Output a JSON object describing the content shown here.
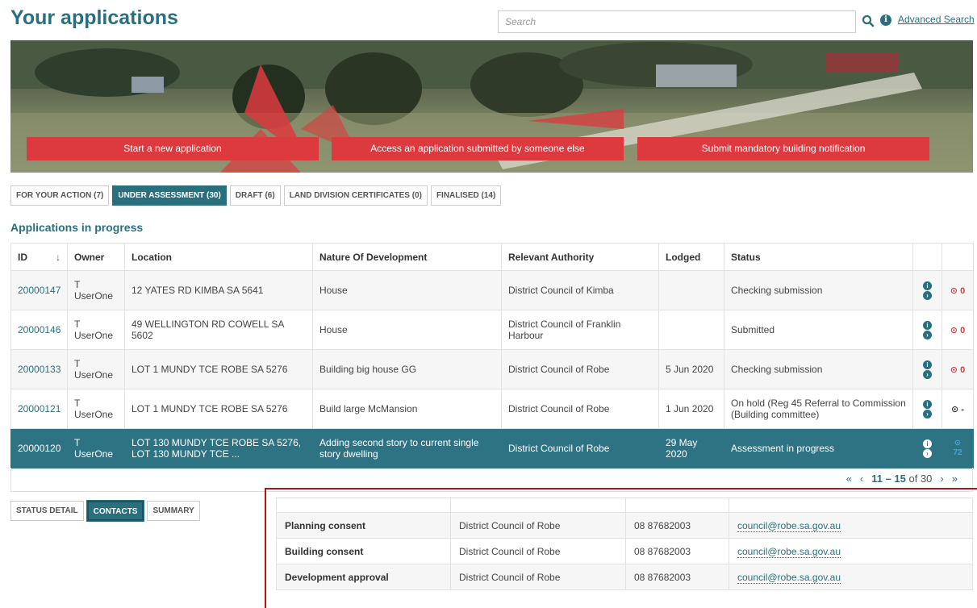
{
  "page_title": "Your applications",
  "search": {
    "placeholder": "Search",
    "advanced_label": "Advanced Search"
  },
  "banner_buttons": [
    "Start a new application",
    "Access an application submitted by someone else",
    "Submit mandatory building notification"
  ],
  "top_tabs": [
    {
      "label": "FOR YOUR ACTION (7)",
      "active": false
    },
    {
      "label": "UNDER ASSESSMENT (30)",
      "active": true
    },
    {
      "label": "DRAFT (6)",
      "active": false
    },
    {
      "label": "LAND DIVISION CERTIFICATES (0)",
      "active": false
    },
    {
      "label": "FINALISED (14)",
      "active": false
    }
  ],
  "section_title": "Applications in progress",
  "table": {
    "headers": [
      "ID",
      "Owner",
      "Location",
      "Nature Of Development",
      "Relevant Authority",
      "Lodged",
      "Status"
    ],
    "sort_icon": "↓",
    "rows": [
      {
        "id": "20000147",
        "owner1": "T",
        "owner2": "UserOne",
        "location": "12 YATES RD KIMBA SA 5641",
        "nature": "House",
        "authority": "District Council of Kimba",
        "lodged": "",
        "status": "Checking submission",
        "clock": "0"
      },
      {
        "id": "20000146",
        "owner1": "T",
        "owner2": "UserOne",
        "location": "49 WELLINGTON RD COWELL SA 5602",
        "nature": "House",
        "authority": "District Council of Franklin Harbour",
        "lodged": "",
        "status": "Submitted",
        "clock": "0"
      },
      {
        "id": "20000133",
        "owner1": "T",
        "owner2": "UserOne",
        "location": "LOT 1 MUNDY TCE ROBE SA 5276",
        "nature": "Building big house GG",
        "authority": "District Council of Robe",
        "lodged": "5 Jun 2020",
        "status": "Checking submission",
        "clock": "0"
      },
      {
        "id": "20000121",
        "owner1": "T",
        "owner2": "UserOne",
        "location": "LOT 1 MUNDY TCE ROBE SA 5276",
        "nature": "Build large McMansion",
        "authority": "District Council of Robe",
        "lodged": "1 Jun 2020",
        "status": "On hold (Reg 45 Referral to Commission (Building committee)",
        "clock": "-"
      },
      {
        "id": "20000120",
        "owner1": "T",
        "owner2": "UserOne",
        "location": "LOT 130 MUNDY TCE ROBE SA 5276, LOT 130 MUNDY TCE ...",
        "nature": "Adding second story to current single story dwelling",
        "authority": "District Council of Robe",
        "lodged": "29 May 2020",
        "status": "Assessment in progress",
        "clock": "72"
      }
    ]
  },
  "pager": {
    "first": "«",
    "prev": "‹",
    "range": "11 – 15",
    "of_label": "of 30",
    "next": "›",
    "last": "»"
  },
  "bottom_tabs": [
    {
      "label": "STATUS DETAIL",
      "active": false
    },
    {
      "label": "CONTACTS",
      "active": true
    },
    {
      "label": "SUMMARY",
      "active": false
    }
  ],
  "contacts": [
    {
      "type": "Planning consent",
      "authority": "District Council of Robe",
      "phone": "08 87682003",
      "email": "council@robe.sa.gov.au"
    },
    {
      "type": "Building consent",
      "authority": "District Council of Robe",
      "phone": "08 87682003",
      "email": "council@robe.sa.gov.au"
    },
    {
      "type": "Development approval",
      "authority": "District Council of Robe",
      "phone": "08 87682003",
      "email": "council@robe.sa.gov.au"
    }
  ],
  "colors": {
    "teal": "#2a6f7e",
    "selected_row": "#2e7384",
    "banner_red": "#dc3a3e",
    "clock_red": "#dc3a3e",
    "frame_red": "#b5121b"
  },
  "icons": {
    "search": "search-icon",
    "info": "info-icon",
    "action": "chevron-right-icon",
    "clock": "clock-icon"
  }
}
